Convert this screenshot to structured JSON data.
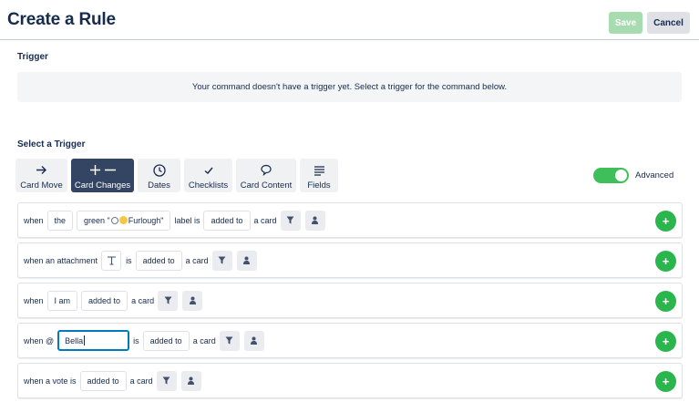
{
  "header": {
    "title": "Create a Rule",
    "save_label": "Save",
    "cancel_label": "Cancel"
  },
  "trigger_section": {
    "title": "Trigger",
    "empty_message": "Your command doesn't have a trigger yet. Select a trigger for the command below."
  },
  "select_section": {
    "title": "Select a Trigger",
    "tabs": [
      {
        "label": "Card Move",
        "icon": "arrow-right-icon",
        "active": false
      },
      {
        "label": "Card Changes",
        "icon": "plus-minus-icon",
        "active": true
      },
      {
        "label": "Dates",
        "icon": "clock-icon",
        "active": false
      },
      {
        "label": "Checklists",
        "icon": "checkmark-icon",
        "active": false
      },
      {
        "label": "Card Content",
        "icon": "comment-icon",
        "active": false
      },
      {
        "label": "Fields",
        "icon": "lines-icon",
        "active": false
      }
    ],
    "advanced_label": "Advanced",
    "advanced_on": true
  },
  "rules": {
    "r1": {
      "when": "when",
      "article": "the",
      "label_value": "green \"",
      "label_value2": "Furlough\"",
      "label_is": "label is",
      "action": "added to",
      "a_card": "a card"
    },
    "r2": {
      "text": "when an attachment",
      "is": "is",
      "action": "added to",
      "a_card": "a card"
    },
    "r3": {
      "when": "when",
      "subject": "I am",
      "action": "added to",
      "a_card": "a card"
    },
    "r4": {
      "when": "when @",
      "input_value": "Bella",
      "is": "is",
      "action": "added to",
      "a_card": "a card"
    },
    "r5": {
      "text": "when a vote is",
      "action": "added to",
      "a_card": "a card"
    }
  },
  "colors": {
    "save_disabled": "#a7dcb0",
    "active_tab": "#344563",
    "add_button": "#2bb54d",
    "toggle_on": "#3fbf5a",
    "focus_border": "#0079bf"
  }
}
